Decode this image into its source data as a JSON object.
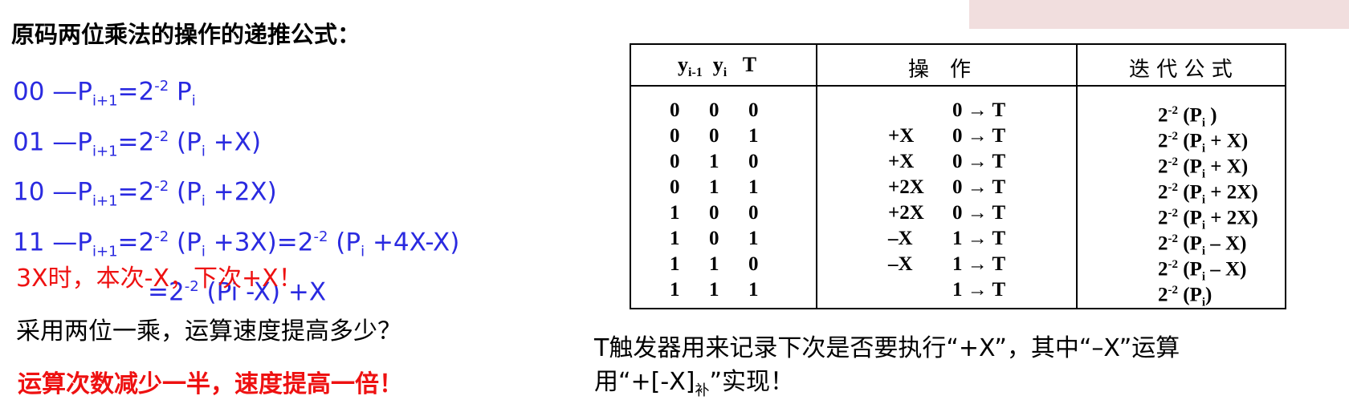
{
  "title": "原码两位乘法的操作的递推公式：",
  "formulas": {
    "l1_prefix": "00 —P",
    "l1_sub": "i+1",
    "l1_a": "=2",
    "l1_sup": "-2",
    "l1_b": " P",
    "l1_sub2": "i",
    "l2_prefix": "01 —P",
    "l2_sub": "i+1",
    "l2_a": "=2",
    "l2_sup": "-2",
    "l2_b": " (P",
    "l2_sub2": "i",
    "l2_c": " +X)",
    "l3_prefix": "10 —P",
    "l3_sub": "i+1",
    "l3_a": "=2",
    "l3_sup": "-2",
    "l3_b": " (P",
    "l3_sub2": "i",
    "l3_c": " +2X)",
    "l4_prefix": "11 —P",
    "l4_sub": "i+1",
    "l4_a": "=2",
    "l4_sup": "-2",
    "l4_b": " (P",
    "l4_sub2": "i",
    "l4_c": " +3X)=2",
    "l4_sup2": "-2",
    "l4_d": " (P",
    "l4_sub3": "i",
    "l4_e": " +4X-X)",
    "l5_a": "=2",
    "l5_sup": "-2",
    "l5_b": " (Pi -X) +X"
  },
  "red_note": "3X时，本次-X，下次+X！",
  "question": "采用两位一乘，运算速度提高多少？",
  "answer": "运算次数减少一半，速度提高一倍！",
  "table": {
    "h1_y1": "y",
    "h1_sub1": "i-1",
    "h1_y2": "y",
    "h1_sub2": "i",
    "h1_t": "T",
    "h2": "操　作",
    "h3": "迭 代 公 式",
    "rows": [
      {
        "b": [
          "0",
          "0",
          "0"
        ],
        "op": "",
        "act": "0 → T",
        "fa": "2",
        "fs": "-2",
        "fb": " (P",
        "fi": "i",
        "fc": " )"
      },
      {
        "b": [
          "0",
          "0",
          "1"
        ],
        "op": "+X",
        "act": "0 → T",
        "fa": "2",
        "fs": "-2",
        "fb": " (P",
        "fi": "i",
        "fc": " + X)"
      },
      {
        "b": [
          "0",
          "1",
          "0"
        ],
        "op": "+X",
        "act": "0 → T",
        "fa": "2",
        "fs": "-2",
        "fb": " (P",
        "fi": "i",
        "fc": " + X)"
      },
      {
        "b": [
          "0",
          "1",
          "1"
        ],
        "op": "+2X",
        "act": "0 → T",
        "fa": "2",
        "fs": "-2",
        "fb": " (P",
        "fi": "i",
        "fc": " + 2X)"
      },
      {
        "b": [
          "1",
          "0",
          "0"
        ],
        "op": "+2X",
        "act": "0 → T",
        "fa": "2",
        "fs": "-2",
        "fb": " (P",
        "fi": "i",
        "fc": " + 2X)"
      },
      {
        "b": [
          "1",
          "0",
          "1"
        ],
        "op": "–X",
        "act": "1 → T",
        "fa": "2",
        "fs": "-2",
        "fb": " (P",
        "fi": "i",
        "fc": " – X)"
      },
      {
        "b": [
          "1",
          "1",
          "0"
        ],
        "op": "–X",
        "act": "1 → T",
        "fa": "2",
        "fs": "-2",
        "fb": " (P",
        "fi": "i",
        "fc": " – X)"
      },
      {
        "b": [
          "1",
          "1",
          "1"
        ],
        "op": "",
        "act": "1 → T",
        "fa": "2",
        "fs": "-2",
        "fb": " (P",
        "fi": "i",
        "fc": ")"
      }
    ]
  },
  "bottom": {
    "line1": "T触发器用来记录下次是否要执行“+X”，其中“–X”运算",
    "line2_a": "用“+[-X]",
    "line2_sub": "补",
    "line2_b": "”实现！"
  }
}
